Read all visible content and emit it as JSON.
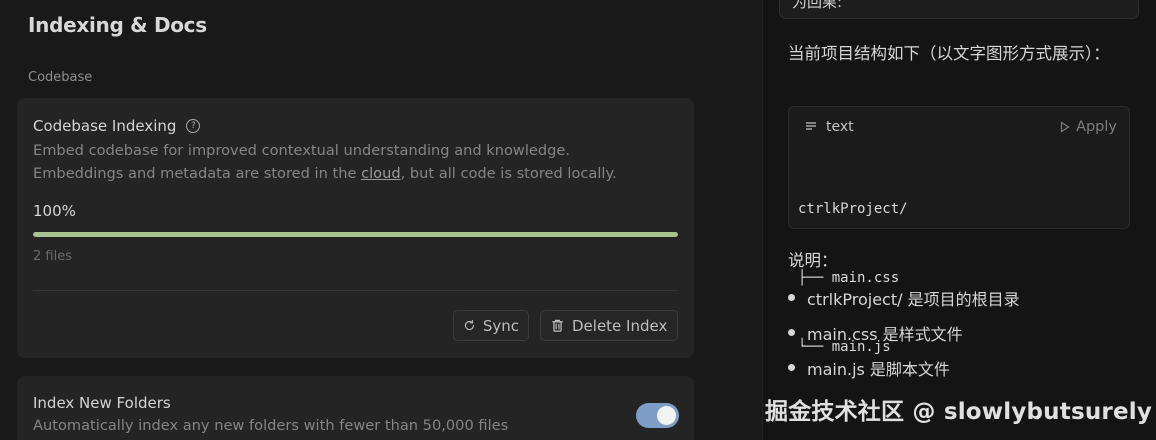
{
  "settings": {
    "page_title": "Indexing & Docs",
    "section_label": "Codebase",
    "indexing_card": {
      "title": "Codebase Indexing",
      "desc_line1": "Embed codebase for improved contextual understanding and knowledge.",
      "desc_line2_prefix": "Embeddings and metadata are stored in the ",
      "desc_line2_link": "cloud",
      "desc_line2_suffix": ", but all code is stored locally.",
      "progress_label": "100%",
      "progress_value": 100,
      "files_count": "2 files",
      "sync_label": "Sync",
      "delete_label": "Delete Index"
    },
    "folders_card": {
      "title": "Index New Folders",
      "desc": "Automatically index any new folders with fewer than 50,000 files",
      "toggle_on": true
    }
  },
  "chat": {
    "top_bubble_text": "为回果:",
    "intro": "当前项目结构如下（以文字图形方式展示）：",
    "code_block": {
      "lang": "text",
      "apply_label": "Apply",
      "lines": [
        "ctrlkProject/",
        "├── main.css",
        "└── main.js"
      ]
    },
    "notes_label": "说明：",
    "notes": [
      "ctrlkProject/ 是项目的根目录",
      "main.css 是样式文件",
      "main.js 是脚本文件"
    ]
  },
  "watermark": "掘金技术社区 @ slowlybutsurely",
  "colors": {
    "progress": "#a9c290",
    "toggle": "#7d9ec7"
  }
}
